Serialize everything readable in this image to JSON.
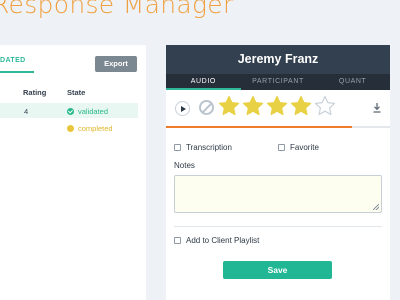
{
  "page": {
    "title": "Response Manager",
    "accent": "#f0a040"
  },
  "left_panel": {
    "active_tab": "DATED",
    "export_label": "Export",
    "columns": [
      "Rating",
      "State"
    ],
    "rows": [
      {
        "rating": "4",
        "state": "validated",
        "state_color": "#27b88b"
      },
      {
        "rating": "",
        "state": "completed",
        "state_color": "#e8c53a"
      }
    ]
  },
  "right_panel": {
    "respondent_name": "Jeremy Franz",
    "tabs": [
      {
        "label": "AUDIO",
        "active": true
      },
      {
        "label": "PARTICIPANT",
        "active": false
      },
      {
        "label": "QUANT",
        "active": false
      }
    ],
    "player": {
      "rating": 4,
      "rating_max": 5,
      "progress": 0.83,
      "progress_color": "#f07c2a",
      "star_color": "#e8d145"
    },
    "transcription_label": "Transcription",
    "favorite_label": "Favorite",
    "notes_label": "Notes",
    "notes_value": "",
    "playlist_label": "Add to Client Playlist",
    "save_label": "Save"
  }
}
